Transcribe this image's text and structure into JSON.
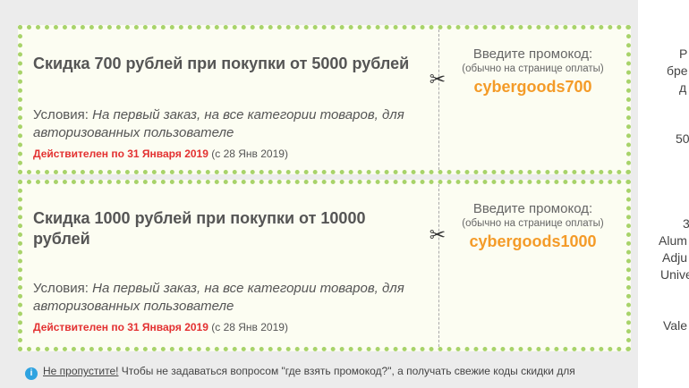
{
  "coupons": [
    {
      "title": "Скидка 700 рублей при покупки от 5000 рублей",
      "conditions_label": "Условия:",
      "conditions_line1": "На первый заказ, на все категории товаров, для",
      "conditions_line2": "авторизованных пользователе",
      "valid_until": "Действителен по 31 Января 2019",
      "valid_from": "(с 28 Янв 2019)",
      "enter_label": "Введите промокод:",
      "enter_hint": "(обычно на странице оплаты)",
      "code": "cybergoods700"
    },
    {
      "title_line1": "Скидка 1000 рублей при покупки от 10000",
      "title_line2": "рублей",
      "conditions_label": "Условия:",
      "conditions_line1": "На первый заказ, на все категории товаров, для",
      "conditions_line2": "авторизованных пользователе",
      "valid_until": "Действителен по 31 Января 2019",
      "valid_from": "(с 28 Янв 2019)",
      "enter_label": "Введите промокод:",
      "enter_hint": "(обычно на странице оплаты)",
      "code": "cybergoods1000"
    }
  ],
  "info": {
    "link": "Не пропустите!",
    "text": "Чтобы не задаваться вопросом \"где взять промокод?\", а получать свежие коды скидки для"
  },
  "sidebar_fragments": [
    "Р",
    "бре",
    "д",
    "50",
    "3",
    "Alum",
    "Adju",
    "Unive",
    "Vale"
  ],
  "colors": {
    "border": "#a8d36a",
    "code": "#f49b28",
    "valid": "#e33131",
    "info_icon": "#2fa3e0"
  }
}
